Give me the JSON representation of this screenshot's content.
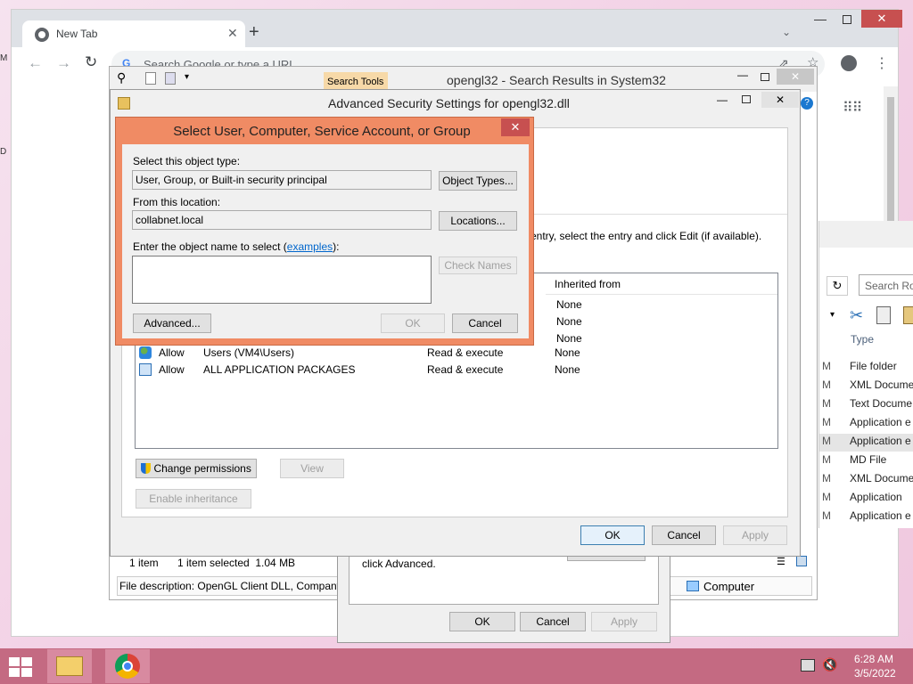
{
  "chrome": {
    "tab_title": "New Tab",
    "omnibox_placeholder": "Search Google or type a URL"
  },
  "explorer": {
    "search_tools_label": "Search Tools",
    "window_title": "opengl32 - Search Results in System32",
    "search_placeholder": "Search Ro",
    "type_header": "Type",
    "types": [
      "File folder",
      "XML Docume",
      "Text Docume",
      "Application e",
      "Application e",
      "MD File",
      "XML Docume",
      "Application",
      "Application e"
    ],
    "m_labels": [
      "M",
      "M",
      "M",
      "M",
      "M",
      "M",
      "M",
      "M",
      "M"
    ],
    "status": {
      "items": "1 item",
      "selected": "1 item selected  1.04 MB"
    },
    "file_description": "File description: OpenGL Client DLL, Company",
    "computer_label": "Computer"
  },
  "props_dialog": {
    "click_advanced": "click Advanced.",
    "ok": "OK",
    "cancel": "Cancel",
    "apply": "Apply"
  },
  "security": {
    "title": "Advanced Security Settings for opengl32.dll",
    "instruction_fragment": "entry, select the entry and click Edit (if available).",
    "inherited_header": "Inherited from",
    "rows_inherited": [
      "None",
      "None",
      "None"
    ],
    "entries": [
      {
        "type": "Allow",
        "principal": "Users (VM4\\Users)",
        "access": "Read & execute",
        "inherited": "None"
      },
      {
        "type": "Allow",
        "principal": "ALL APPLICATION PACKAGES",
        "access": "Read & execute",
        "inherited": "None"
      }
    ],
    "change_permissions": "Change permissions",
    "view": "View",
    "enable_inheritance": "Enable inheritance",
    "ok": "OK",
    "cancel": "Cancel",
    "apply": "Apply"
  },
  "select_dialog": {
    "title": "Select User, Computer, Service Account, or Group",
    "object_type_label": "Select this object type:",
    "object_type_value": "User, Group, or Built-in security principal",
    "object_types_button": "Object Types...",
    "location_label": "From this location:",
    "location_value": "collabnet.local",
    "locations_button": "Locations...",
    "enter_label_prefix": "Enter the object name to select (",
    "examples_link": "examples",
    "enter_label_suffix": "):",
    "check_names": "Check Names",
    "advanced": "Advanced...",
    "ok": "OK",
    "cancel": "Cancel"
  },
  "taskbar": {
    "time": "6:28 AM",
    "date": "3/5/2022"
  },
  "colors": {
    "dialog_accent": "#f08b64",
    "taskbar": "#c46a82",
    "link": "#0066cc"
  }
}
